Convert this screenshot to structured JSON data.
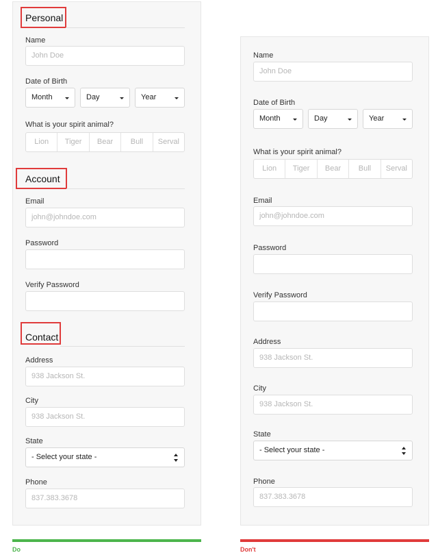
{
  "colors": {
    "do": "#4cb54c",
    "dont": "#e03b3b",
    "highlight": "#e03b3b"
  },
  "form": {
    "sections": {
      "personal": "Personal",
      "account": "Account",
      "contact": "Contact"
    },
    "name": {
      "label": "Name",
      "placeholder": "John Doe"
    },
    "dob": {
      "label": "Date of Birth",
      "month": "Month",
      "day": "Day",
      "year": "Year"
    },
    "spirit": {
      "label": "What is your spirit animal?",
      "options": [
        "Lion",
        "Tiger",
        "Bear",
        "Bull",
        "Serval"
      ]
    },
    "email": {
      "label": "Email",
      "placeholder": "john@johndoe.com"
    },
    "password": {
      "label": "Password",
      "placeholder": ""
    },
    "verify": {
      "label": "Verify Password",
      "placeholder": ""
    },
    "address": {
      "label": "Address",
      "placeholder": "938 Jackson St."
    },
    "city": {
      "label": "City",
      "placeholder": "938 Jackson St."
    },
    "state": {
      "label": "State",
      "selected": "- Select your state -"
    },
    "phone": {
      "label": "Phone",
      "placeholder": "837.383.3678"
    }
  },
  "captions": {
    "do": "Do",
    "dont": "Don't"
  }
}
